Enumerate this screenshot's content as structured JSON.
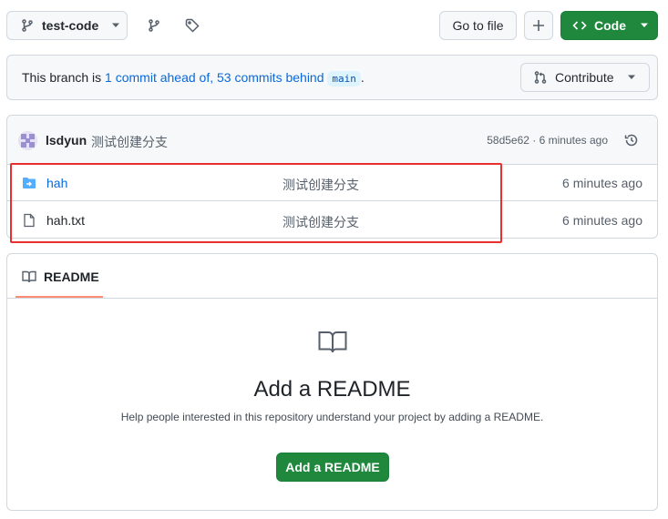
{
  "toolbar": {
    "branch_name": "test-code",
    "goto_file_label": "Go to file",
    "code_label": "Code"
  },
  "banner": {
    "prefix": "This branch is ",
    "ahead_link": "1 commit ahead of,",
    "behind_link": "53 commits behind",
    "base_branch": "main",
    "suffix": ".",
    "contribute_label": "Contribute"
  },
  "latest_commit": {
    "author": "lsdyun",
    "message": "测试创建分支",
    "meta": "58d5e62 · 6 minutes ago"
  },
  "files": [
    {
      "name": "hah",
      "type": "directory",
      "message": "测试创建分支",
      "time": "6 minutes ago"
    },
    {
      "name": "hah.txt",
      "type": "file",
      "message": "测试创建分支",
      "time": "6 minutes ago"
    }
  ],
  "readme": {
    "tab_label": "README",
    "title": "Add a README",
    "description": "Help people interested in this repository understand your project by adding a README.",
    "button_label": "Add a README"
  },
  "colors": {
    "primary_green": "#1f883d",
    "link_blue": "#0969da",
    "highlight_red": "#e8302e",
    "tab_underline": "#fd8c73"
  }
}
